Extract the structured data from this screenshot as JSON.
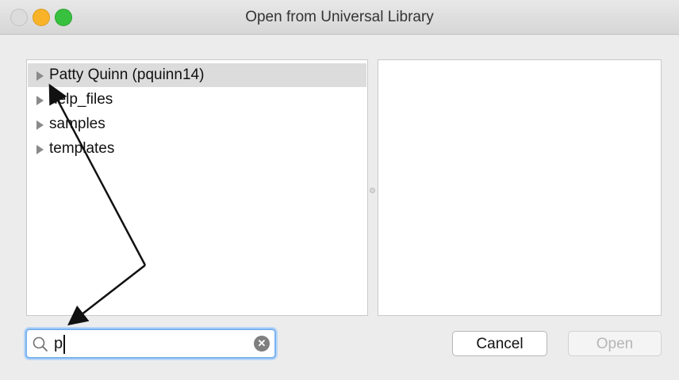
{
  "window": {
    "title": "Open from Universal Library"
  },
  "tree": {
    "items": [
      {
        "label": "Patty Quinn (pquinn14)",
        "selected": true
      },
      {
        "label": "help_files",
        "selected": false
      },
      {
        "label": "samples",
        "selected": false
      },
      {
        "label": "templates",
        "selected": false
      }
    ]
  },
  "search": {
    "value": "p",
    "icon": "magnifier-icon",
    "clear_icon": "clear-x-icon"
  },
  "buttons": {
    "cancel_label": "Cancel",
    "open_label": "Open",
    "open_enabled": false
  },
  "colors": {
    "focus_ring": "#7ab3ee",
    "selection": "#dcdcdc",
    "minimize": "#f8b329",
    "zoom": "#38c13f"
  }
}
